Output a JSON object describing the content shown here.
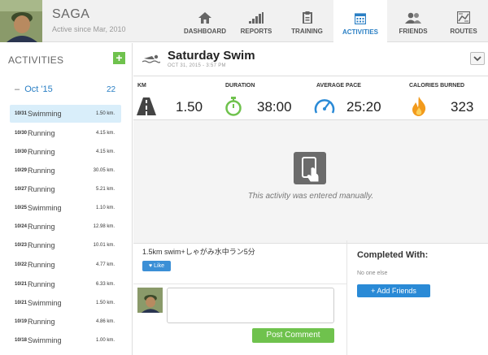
{
  "user": {
    "name": "SAGA",
    "since": "Active since Mar, 2010"
  },
  "nav": [
    {
      "label": "DASHBOARD",
      "icon": "home-icon"
    },
    {
      "label": "REPORTS",
      "icon": "bar-chart-icon"
    },
    {
      "label": "TRAINING",
      "icon": "clipboard-icon"
    },
    {
      "label": "ACTIVITIES",
      "icon": "calendar-icon",
      "active": true
    },
    {
      "label": "FRIENDS",
      "icon": "friends-icon"
    },
    {
      "label": "ROUTES",
      "icon": "map-icon"
    }
  ],
  "sidebar": {
    "title": "ACTIVITIES",
    "add_label": "+",
    "month": {
      "label": "Oct '15",
      "count": "22",
      "toggle": "–"
    },
    "activities": [
      {
        "date": "10/31",
        "type": "Swimming",
        "dist": "1.50 km.",
        "selected": true
      },
      {
        "date": "10/30",
        "type": "Running",
        "dist": "4.15 km."
      },
      {
        "date": "10/30",
        "type": "Running",
        "dist": "4.15 km."
      },
      {
        "date": "10/29",
        "type": "Running",
        "dist": "30.05 km."
      },
      {
        "date": "10/27",
        "type": "Running",
        "dist": "5.21 km."
      },
      {
        "date": "10/25",
        "type": "Swimming",
        "dist": "1.10 km."
      },
      {
        "date": "10/24",
        "type": "Running",
        "dist": "12.98 km."
      },
      {
        "date": "10/23",
        "type": "Running",
        "dist": "10.01 km."
      },
      {
        "date": "10/22",
        "type": "Running",
        "dist": "4.77 km."
      },
      {
        "date": "10/21",
        "type": "Running",
        "dist": "6.33 km."
      },
      {
        "date": "10/21",
        "type": "Swimming",
        "dist": "1.50 km."
      },
      {
        "date": "10/19",
        "type": "Running",
        "dist": "4.86 km."
      },
      {
        "date": "10/18",
        "type": "Swimming",
        "dist": "1.00 km."
      }
    ]
  },
  "activity": {
    "title": "Saturday Swim",
    "datetime": "OCT 31, 2015  -  3:57 PM",
    "stats": [
      {
        "label": "KM",
        "value": "1.50",
        "icon": "road-icon"
      },
      {
        "label": "DURATION",
        "value": "38:00",
        "icon": "stopwatch-icon"
      },
      {
        "label": "AVERAGE PACE",
        "value": "25:20",
        "icon": "speedometer-icon"
      },
      {
        "label": "CALORIES BURNED",
        "value": "323",
        "icon": "flame-icon"
      }
    ],
    "manual_text": "This activity was entered manually.",
    "note": "1.5km swim+しゃがみ水中ラン5分",
    "like_label": "Like"
  },
  "comment": {
    "button": "Post Comment",
    "placeholder": ""
  },
  "completed_with": {
    "title": "Completed With:",
    "none": "No one else",
    "add_button": "+ Add Friends"
  },
  "colors": {
    "accent": "#2a7fc4",
    "green": "#6fc24d",
    "selected_bg": "#d9eefa"
  }
}
